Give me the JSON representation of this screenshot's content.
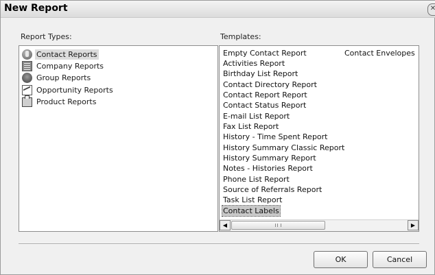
{
  "dialog": {
    "title": "New Report",
    "ok_label": "OK",
    "cancel_label": "Cancel"
  },
  "report_types": {
    "label": "Report Types:",
    "items": [
      {
        "label": "Contact Reports",
        "icon": "contact-icon",
        "selected": true
      },
      {
        "label": "Company Reports",
        "icon": "company-icon"
      },
      {
        "label": "Group Reports",
        "icon": "group-icon"
      },
      {
        "label": "Opportunity Reports",
        "icon": "opportunity-icon"
      },
      {
        "label": "Product Reports",
        "icon": "product-icon"
      }
    ]
  },
  "templates": {
    "label": "Templates:",
    "items": [
      "Empty Contact Report",
      "Activities Report",
      "Birthday List Report",
      "Contact Directory Report",
      "Contact Report Report",
      "Contact Status Report",
      "E-mail List Report",
      "Fax List Report",
      "History - Time Spent Report",
      "History Summary Classic Report",
      "History Summary Report",
      "Notes - Histories Report",
      "Phone List Report",
      "Source of Referrals Report",
      "Task List Report",
      "Contact Labels"
    ],
    "second_column": [
      "Contact Envelopes"
    ],
    "selected": "Contact Labels"
  }
}
